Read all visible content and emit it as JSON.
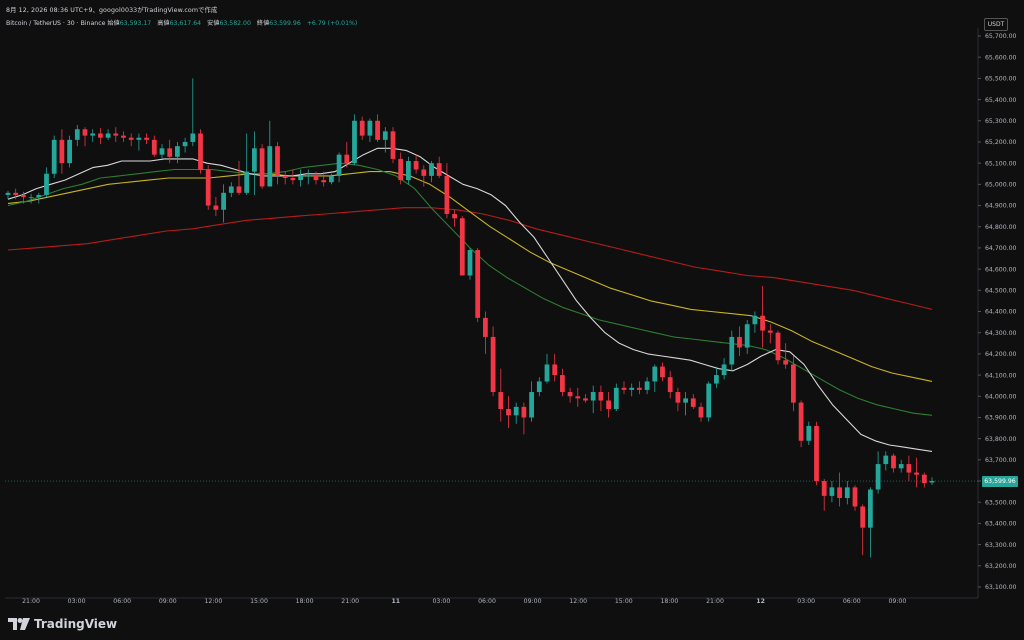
{
  "header": {
    "timestamp": "8月 12, 2026 08:36 UTC+9、googol0033がTradingView.comで作成",
    "symbol": "Bitcoin / TetherUS · 30 · Binance",
    "open_label": "始値",
    "open_value": "63,593.17",
    "high_label": "高値",
    "high_value": "63,617.64",
    "low_label": "安値",
    "low_value": "63,582.00",
    "close_label": "終値",
    "close_value": "63,599.96",
    "change": "+6.79 (+0.01%)"
  },
  "currency": "USDT",
  "last_price": "63,599.96",
  "brand": "TradingView",
  "colors": {
    "background": "#0f0f0f",
    "up": "#26a69a",
    "down": "#f23645",
    "ma_white": "#d8d8d8",
    "ma_green": "#2e7d32",
    "ma_yellow": "#c9b420",
    "ma_red": "#b71c1c"
  },
  "chart_data": {
    "type": "candlestick",
    "y_ticks": [
      "65,700.00",
      "65,600.00",
      "65,500.00",
      "65,400.00",
      "65,300.00",
      "65,200.00",
      "65,100.00",
      "65,000.00",
      "64,900.00",
      "64,800.00",
      "64,700.00",
      "64,600.00",
      "64,500.00",
      "64,400.00",
      "64,300.00",
      "64,200.00",
      "64,100.00",
      "64,000.00",
      "63,900.00",
      "63,800.00",
      "63,700.00",
      "63,600.00",
      "63,500.00",
      "63,400.00",
      "63,300.00",
      "63,200.00",
      "63,100.00"
    ],
    "ylim": [
      63100,
      65700
    ],
    "x_ticks": [
      "21:00",
      "03:00",
      "06:00",
      "09:00",
      "12:00",
      "15:00",
      "18:00",
      "21:00",
      "11",
      "03:00",
      "06:00",
      "09:00",
      "12:00",
      "15:00",
      "18:00",
      "21:00",
      "12",
      "03:00",
      "06:00",
      "09:00"
    ],
    "candles": [
      [
        64950,
        64970,
        64930,
        64960
      ],
      [
        64960,
        64980,
        64930,
        64950
      ],
      [
        64950,
        64965,
        64910,
        64940
      ],
      [
        64940,
        64955,
        64910,
        64940
      ],
      [
        64940,
        64960,
        64910,
        64950
      ],
      [
        64950,
        65080,
        64940,
        65050
      ],
      [
        65050,
        65230,
        65030,
        65210
      ],
      [
        65210,
        65260,
        65050,
        65100
      ],
      [
        65100,
        65230,
        65080,
        65210
      ],
      [
        65210,
        65280,
        65180,
        65260
      ],
      [
        65260,
        65270,
        65180,
        65230
      ],
      [
        65230,
        65260,
        65200,
        65240
      ],
      [
        65240,
        65265,
        65190,
        65220
      ],
      [
        65220,
        65260,
        65210,
        65240
      ],
      [
        65240,
        65270,
        65200,
        65230
      ],
      [
        65230,
        65250,
        65200,
        65220
      ],
      [
        65220,
        65240,
        65180,
        65210
      ],
      [
        65210,
        65240,
        65160,
        65220
      ],
      [
        65220,
        65240,
        65190,
        65210
      ],
      [
        65210,
        65230,
        65130,
        65140
      ],
      [
        65140,
        65190,
        65120,
        65170
      ],
      [
        65170,
        65210,
        65100,
        65130
      ],
      [
        65130,
        65200,
        65100,
        65180
      ],
      [
        65180,
        65220,
        65150,
        65200
      ],
      [
        65200,
        65500,
        65180,
        65240
      ],
      [
        65240,
        65260,
        65050,
        65070
      ],
      [
        65070,
        65090,
        64880,
        64900
      ],
      [
        64900,
        64940,
        64850,
        64880
      ],
      [
        64880,
        65000,
        64820,
        64960
      ],
      [
        64960,
        65010,
        64940,
        64990
      ],
      [
        64990,
        65110,
        64950,
        64960
      ],
      [
        64960,
        65240,
        64950,
        65060
      ],
      [
        65060,
        65250,
        64950,
        65170
      ],
      [
        65170,
        65190,
        64980,
        64990
      ],
      [
        64990,
        65300,
        64990,
        65180
      ],
      [
        65180,
        65200,
        65000,
        65040
      ],
      [
        65040,
        65060,
        65000,
        65030
      ],
      [
        65030,
        65070,
        65000,
        65020
      ],
      [
        65020,
        65070,
        64990,
        65040
      ],
      [
        65040,
        65070,
        65000,
        65040
      ],
      [
        65040,
        65060,
        65000,
        65020
      ],
      [
        65020,
        65060,
        64990,
        65010
      ],
      [
        65010,
        65050,
        65000,
        65040
      ],
      [
        65040,
        65150,
        65010,
        65140
      ],
      [
        65140,
        65200,
        65080,
        65100
      ],
      [
        65100,
        65330,
        65090,
        65300
      ],
      [
        65300,
        65320,
        65210,
        65230
      ],
      [
        65230,
        65310,
        65200,
        65300
      ],
      [
        65300,
        65330,
        65200,
        65210
      ],
      [
        65210,
        65270,
        65150,
        65250
      ],
      [
        65250,
        65270,
        65100,
        65120
      ],
      [
        65120,
        65150,
        65000,
        65020
      ],
      [
        65020,
        65130,
        65000,
        65110
      ],
      [
        65110,
        65140,
        65050,
        65070
      ],
      [
        65070,
        65090,
        64990,
        65040
      ],
      [
        65040,
        65110,
        65010,
        65100
      ],
      [
        65100,
        65130,
        65030,
        65040
      ],
      [
        65040,
        65100,
        64840,
        64860
      ],
      [
        64860,
        64880,
        64800,
        64840
      ],
      [
        64840,
        64850,
        64570,
        64570
      ],
      [
        64570,
        64700,
        64550,
        64690
      ],
      [
        64690,
        64700,
        64350,
        64370
      ],
      [
        64370,
        64400,
        64200,
        64280
      ],
      [
        64280,
        64330,
        64000,
        64020
      ],
      [
        64020,
        64130,
        63880,
        63940
      ],
      [
        63940,
        64000,
        63850,
        63910
      ],
      [
        63910,
        63970,
        63870,
        63950
      ],
      [
        63950,
        63970,
        63820,
        63900
      ],
      [
        63900,
        64070,
        63880,
        64020
      ],
      [
        64020,
        64090,
        64000,
        64070
      ],
      [
        64070,
        64200,
        64060,
        64150
      ],
      [
        64150,
        64200,
        64070,
        64100
      ],
      [
        64100,
        64130,
        64000,
        64020
      ],
      [
        64020,
        64040,
        63970,
        64000
      ],
      [
        64000,
        64040,
        63950,
        63990
      ],
      [
        63990,
        64010,
        63970,
        63980
      ],
      [
        63980,
        64050,
        63920,
        64020
      ],
      [
        64020,
        64050,
        63930,
        63980
      ],
      [
        63980,
        64020,
        63900,
        63940
      ],
      [
        63940,
        64060,
        63930,
        64040
      ],
      [
        64040,
        64070,
        64010,
        64030
      ],
      [
        64030,
        64060,
        64000,
        64040
      ],
      [
        64040,
        64070,
        64010,
        64030
      ],
      [
        64030,
        64090,
        64010,
        64070
      ],
      [
        64070,
        64150,
        64020,
        64140
      ],
      [
        64140,
        64160,
        64070,
        64090
      ],
      [
        64090,
        64120,
        63990,
        64020
      ],
      [
        64020,
        64040,
        63930,
        63970
      ],
      [
        63970,
        64020,
        63910,
        63990
      ],
      [
        63990,
        64010,
        63940,
        63950
      ],
      [
        63950,
        63970,
        63880,
        63900
      ],
      [
        63900,
        64070,
        63880,
        64060
      ],
      [
        64060,
        64140,
        64040,
        64100
      ],
      [
        64100,
        64180,
        64080,
        64150
      ],
      [
        64150,
        64310,
        64120,
        64280
      ],
      [
        64280,
        64330,
        64190,
        64230
      ],
      [
        64230,
        64360,
        64200,
        64340
      ],
      [
        64340,
        64400,
        64300,
        64380
      ],
      [
        64380,
        64520,
        64230,
        64310
      ],
      [
        64310,
        64340,
        64250,
        64300
      ],
      [
        64300,
        64310,
        64150,
        64170
      ],
      [
        64170,
        64250,
        64130,
        64150
      ],
      [
        64150,
        64190,
        63930,
        63970
      ],
      [
        63970,
        63980,
        63760,
        63790
      ],
      [
        63790,
        63880,
        63770,
        63860
      ],
      [
        63860,
        63880,
        63580,
        63600
      ],
      [
        63600,
        63610,
        63460,
        63530
      ],
      [
        63530,
        63600,
        63500,
        63570
      ],
      [
        63570,
        63640,
        63480,
        63520
      ],
      [
        63520,
        63600,
        63490,
        63570
      ],
      [
        63570,
        63580,
        63460,
        63480
      ],
      [
        63480,
        63490,
        63250,
        63380
      ],
      [
        63380,
        63570,
        63240,
        63560
      ],
      [
        63560,
        63740,
        63540,
        63680
      ],
      [
        63680,
        63740,
        63650,
        63720
      ],
      [
        63720,
        63730,
        63640,
        63660
      ],
      [
        63660,
        63700,
        63640,
        63680
      ],
      [
        63680,
        63720,
        63600,
        63640
      ],
      [
        63640,
        63710,
        63570,
        63630
      ],
      [
        63630,
        63640,
        63570,
        63590
      ],
      [
        63593,
        63618,
        63582,
        63600
      ]
    ],
    "ma_white": [
      64930,
      64950,
      64980,
      65000,
      65020,
      65050,
      65080,
      65090,
      65110,
      65110,
      65110,
      65120,
      65120,
      65120,
      65100,
      65090,
      65070,
      65050,
      65040,
      65040,
      65040,
      65050,
      65050,
      65060,
      65100,
      65140,
      65170,
      65170,
      65160,
      65130,
      65080,
      65040,
      65000,
      64980,
      64950,
      64900,
      64820,
      64750,
      64650,
      64550,
      64450,
      64370,
      64300,
      64250,
      64220,
      64200,
      64190,
      64180,
      64170,
      64150,
      64130,
      64120,
      64150,
      64190,
      64220,
      64210,
      64150,
      64050,
      63960,
      63890,
      63820,
      63790,
      63770,
      63760,
      63750,
      63740
    ],
    "ma_green": [
      64900,
      64920,
      64950,
      64980,
      65000,
      65030,
      65040,
      65050,
      65060,
      65070,
      65070,
      65070,
      65060,
      65050,
      65050,
      65060,
      65080,
      65090,
      65100,
      65090,
      65070,
      65040,
      64980,
      64880,
      64790,
      64700,
      64620,
      64560,
      64510,
      64460,
      64420,
      64390,
      64360,
      64340,
      64320,
      64300,
      64280,
      64270,
      64260,
      64250,
      64240,
      64220,
      64180,
      64130,
      64080,
      64030,
      63990,
      63960,
      63940,
      63920,
      63910
    ],
    "ma_yellow": [
      64910,
      64920,
      64940,
      64960,
      64980,
      65000,
      65010,
      65020,
      65030,
      65030,
      65030,
      65040,
      65050,
      65050,
      65040,
      65040,
      65040,
      65050,
      65060,
      65060,
      65040,
      65000,
      64940,
      64870,
      64800,
      64740,
      64680,
      64630,
      64590,
      64550,
      64510,
      64480,
      64450,
      64430,
      64410,
      64400,
      64390,
      64380,
      64350,
      64310,
      64260,
      64220,
      64180,
      64140,
      64110,
      64090,
      64070
    ],
    "ma_red": [
      64690,
      64700,
      64710,
      64720,
      64740,
      64760,
      64780,
      64790,
      64810,
      64830,
      64840,
      64850,
      64860,
      64870,
      64880,
      64890,
      64890,
      64880,
      64860,
      64830,
      64790,
      64760,
      64730,
      64700,
      64670,
      64640,
      64610,
      64590,
      64570,
      64560,
      64540,
      64520,
      64500,
      64470,
      64440,
      64410
    ]
  }
}
